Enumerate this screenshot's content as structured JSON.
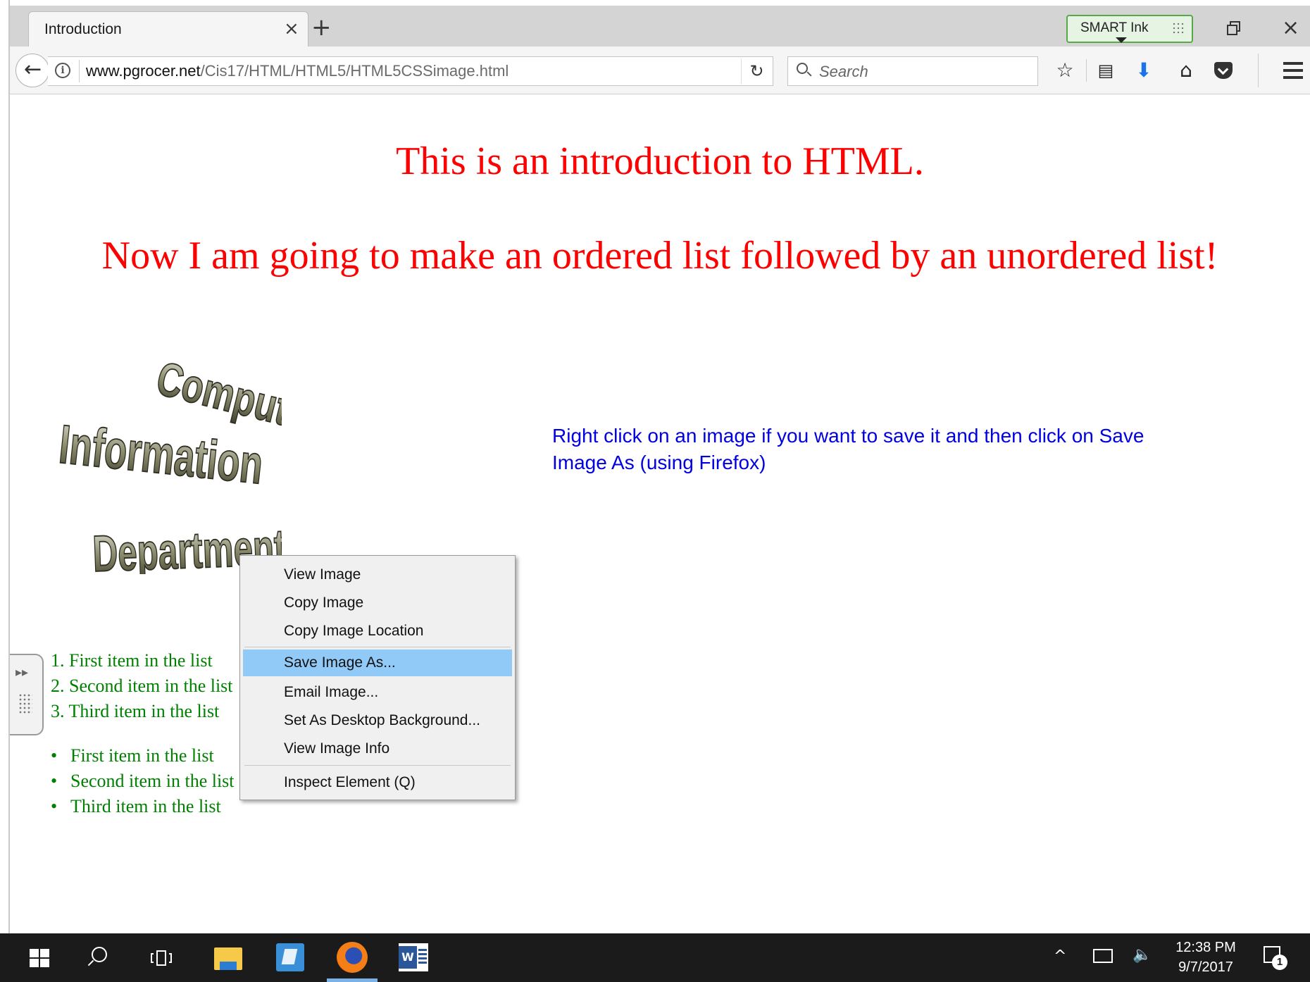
{
  "browser": {
    "tab_title": "Introduction",
    "tab_close_glyph": "×",
    "new_tab_glyph": "+",
    "smart_ink_label": "SMART Ink",
    "close_glyph": "×",
    "url_domain": "www.pgrocer.net",
    "url_path": "/Cis17/HTML/HTML5/HTML5CSSimage.html",
    "search_placeholder": "Search",
    "icons": [
      "back-arrow-icon",
      "info-icon",
      "reload-icon",
      "search-icon",
      "bookmark-star-icon",
      "reading-list-icon",
      "download-icon",
      "home-icon",
      "pocket-icon",
      "hamburger-menu-icon"
    ]
  },
  "page": {
    "heading1": "This is an introduction to HTML.",
    "heading2": "Now I am going to make an ordered list followed by an unordered list!",
    "image_words": [
      "Computer",
      "Information",
      "Department"
    ],
    "hint": "Right click on an image if you want to save it and then click on Save Image As (using Firefox)",
    "ordered_list": [
      "1. First item in the list",
      "2. Second item in the list",
      "3. Third item in the list"
    ],
    "unordered_list": [
      "First item in the list",
      "Second item in the list",
      "Third item in the list"
    ],
    "colors": {
      "heading": "#ff0000",
      "hint": "#0000e0",
      "lists": "#008000",
      "menu_highlight": "#91c9f7"
    }
  },
  "context_menu": {
    "items": [
      {
        "label": "View Image"
      },
      {
        "label": "Copy Image"
      },
      {
        "label": "Copy Image Location"
      },
      {
        "label": "Save Image As...",
        "highlighted": true
      },
      {
        "label": "Email Image..."
      },
      {
        "label": "Set As Desktop Background..."
      },
      {
        "label": "View Image Info"
      },
      {
        "label": "Inspect Element (Q)"
      }
    ]
  },
  "taskbar": {
    "time": "12:38 PM",
    "date": "9/7/2017",
    "notification_count": "1",
    "word_glyph": "W",
    "tray_chevron": "^",
    "volume_glyph": "🔈"
  }
}
